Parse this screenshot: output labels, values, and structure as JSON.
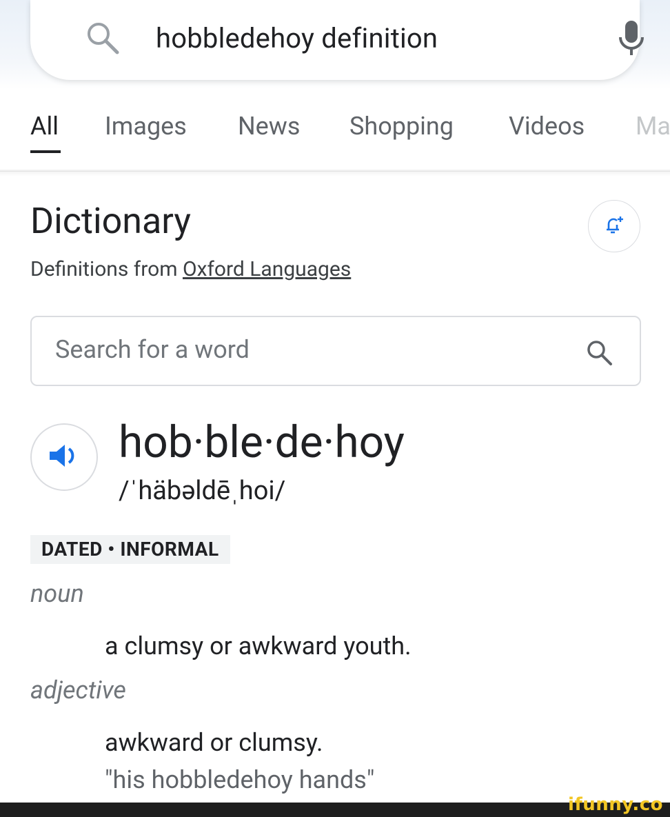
{
  "search": {
    "query": "hobbledehoy definition"
  },
  "tabs": [
    {
      "label": "All",
      "active": true
    },
    {
      "label": "Images"
    },
    {
      "label": "News"
    },
    {
      "label": "Shopping"
    },
    {
      "label": "Videos"
    },
    {
      "label": "Ma"
    }
  ],
  "dictionary": {
    "title": "Dictionary",
    "source_prefix": "Definitions from",
    "source_link": "Oxford Languages",
    "search_placeholder": "Search for a word",
    "headword": "hob·ble·de·hoy",
    "phonetic": "/ˈhäbəldēˌhoi/",
    "label": "DATED • INFORMAL",
    "senses": [
      {
        "pos": "noun",
        "definition": "a clumsy or awkward youth."
      },
      {
        "pos": "adjective",
        "definition": "awkward or clumsy.",
        "example": "\"his hobbledehoy hands\""
      }
    ]
  },
  "watermark": "ifunny.co",
  "colors": {
    "accent_blue": "#1a73e8",
    "watermark_yellow": "#f2c624"
  }
}
